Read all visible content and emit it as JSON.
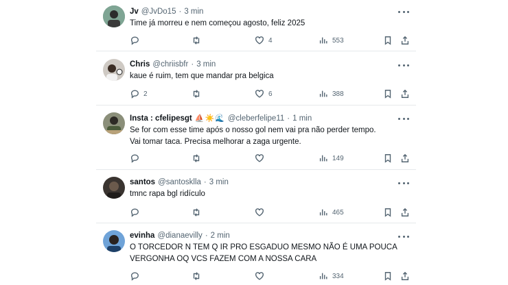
{
  "posts": [
    {
      "name": "Jv",
      "handle": "@JvDo15",
      "time": "3 min",
      "text_lines": [
        "Time já morreu e nem começou agosto, feliz 2025"
      ],
      "replies": "",
      "reposts": "",
      "likes": "4",
      "views": "553",
      "avatar_color": "#6a8a7d"
    },
    {
      "name": "Chris",
      "handle": "@chriisbfr",
      "time": "3 min",
      "text_lines": [
        "kaue é ruim, tem que mandar pra belgica"
      ],
      "replies": "2",
      "reposts": "",
      "likes": "6",
      "views": "388",
      "avatar_color": "#4a4a4a"
    },
    {
      "name": "Insta : cfelipesgt",
      "emojis": "⛵☀️🌊",
      "handle": "@cleberfelipe11",
      "time": "1 min",
      "text_lines": [
        "Se for com esse time após o nosso gol nem vai pra não perder tempo.",
        "Vai tomar taca. Precisa melhorar a zaga urgente."
      ],
      "replies": "",
      "reposts": "",
      "likes": "",
      "views": "149",
      "avatar_color": "#5c6e4a"
    },
    {
      "name": "santos",
      "handle": "@santosklla",
      "time": "3 min",
      "text_lines": [
        "tmnc rapa bgl ridículo"
      ],
      "replies": "",
      "reposts": "",
      "likes": "",
      "views": "465",
      "avatar_color": "#2f2a26"
    },
    {
      "name": "evinha",
      "handle": "@dianaevilly",
      "time": "2 min",
      "text_lines": [
        "O TORCEDOR N TEM Q IR PRO ESGADUO MESMO NÃO É UMA POUCA",
        "VERGONHA OQ VCS FAZEM COM A NOSSA CARA"
      ],
      "replies": "",
      "reposts": "",
      "likes": "",
      "views": "334",
      "avatar_color": "#3e6fa8"
    }
  ],
  "separator": "·"
}
